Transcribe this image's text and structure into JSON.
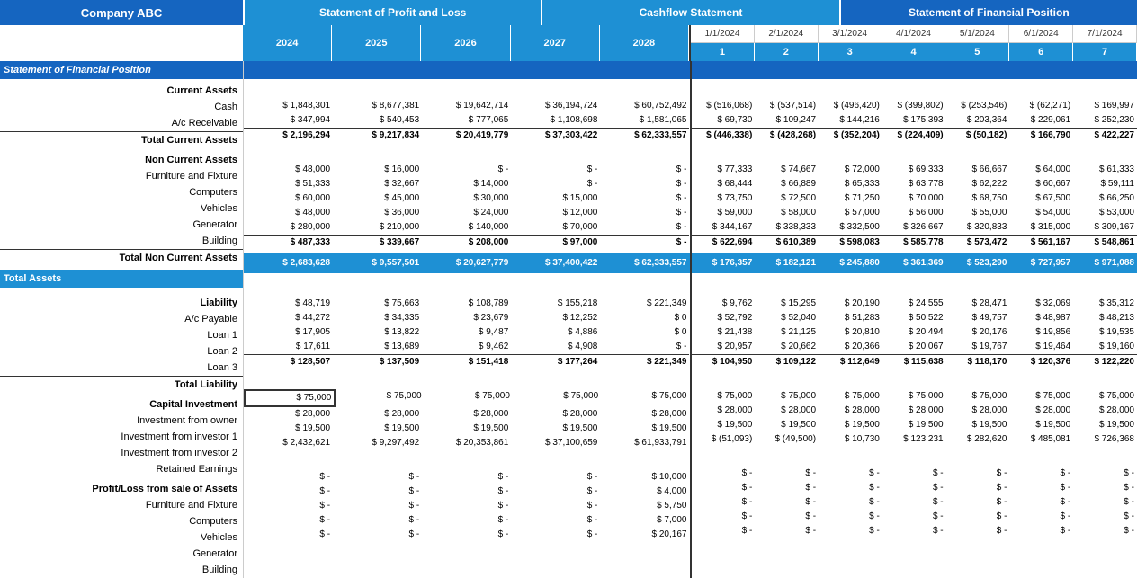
{
  "header": {
    "company": "Company ABC",
    "tab_pl": "Statement of Profit and Loss",
    "tab_cf": "Cashflow Statement",
    "tab_sfp": "Statement of Financial Position"
  },
  "pl_years": [
    "2024",
    "2025",
    "2026",
    "2027",
    "2028"
  ],
  "cf_years": [
    "2024",
    "2025",
    "2026",
    "2027",
    "2028"
  ],
  "sfp_months": [
    {
      "date": "1/1/2024",
      "num": "1"
    },
    {
      "date": "2/1/2024",
      "num": "2"
    },
    {
      "date": "3/1/2024",
      "num": "3"
    },
    {
      "date": "4/1/2024",
      "num": "4"
    },
    {
      "date": "5/1/2024",
      "num": "5"
    },
    {
      "date": "6/1/2024",
      "num": "6"
    },
    {
      "date": "7/1/2024",
      "num": "7"
    }
  ],
  "labels": {
    "section_sfp": "Statement of Financial Position",
    "current_assets": "Current Assets",
    "cash": "Cash",
    "ac_receivable": "A/c Receivable",
    "total_current_assets": "Total Current Assets",
    "non_current_assets": "Non Current Assets",
    "furniture": "Furniture and Fixture",
    "computers": "Computers",
    "vehicles": "Vehicles",
    "generator": "Generator",
    "building": "Building",
    "total_non_current_assets": "Total Non Current Assets",
    "total_assets": "Total Assets",
    "liability": "Liability",
    "ac_payable": "A/c Payable",
    "loan1": "Loan 1",
    "loan2": "Loan 2",
    "loan3": "Loan 3",
    "total_liability": "Total Liability",
    "capital_investment": "Capital Investment",
    "investment_owner": "Investment from owner",
    "investment_investor1": "Investment from investor 1",
    "investment_investor2": "Investment from investor 2",
    "retained_earnings": "Retained Earnings",
    "profit_loss_sale": "Profit/Loss from sale of Assets",
    "furniture2": "Furniture and Fixture",
    "computers2": "Computers",
    "vehicles2": "Vehicles",
    "generator2": "Generator",
    "building2": "Building"
  },
  "pl_data": {
    "cash": [
      "$ 1,848,301",
      "$ 8,677,381",
      "$ 19,642,714",
      "$ 36,194,724",
      "$ 60,752,492"
    ],
    "ac_receivable": [
      "$ 347,994",
      "$ 540,453",
      "$ 777,065",
      "$ 1,108,698",
      "$ 1,581,065"
    ],
    "total_current_assets": [
      "$ 2,196,294",
      "$ 9,217,834",
      "$ 20,419,779",
      "$ 37,303,422",
      "$ 62,333,557"
    ],
    "furniture": [
      "$ 48,000",
      "$ 16,000",
      "$ -",
      "$ -",
      "$ -"
    ],
    "computers": [
      "$ 51,333",
      "$ 32,667",
      "$ 14,000",
      "$ -",
      "$ -"
    ],
    "vehicles": [
      "$ 60,000",
      "$ 45,000",
      "$ 30,000",
      "$ 15,000",
      "$ -"
    ],
    "generator": [
      "$ 48,000",
      "$ 36,000",
      "$ 24,000",
      "$ 12,000",
      "$ -"
    ],
    "building": [
      "$ 280,000",
      "$ 210,000",
      "$ 140,000",
      "$ 70,000",
      "$ -"
    ],
    "total_non_current_assets": [
      "$ 487,333",
      "$ 339,667",
      "$ 208,000",
      "$ 97,000",
      "$ -"
    ],
    "total_assets": [
      "$ 2,683,628",
      "$ 9,557,501",
      "$ 20,627,779",
      "$ 37,400,422",
      "$ 62,333,557"
    ],
    "ac_payable": [
      "$ 48,719",
      "$ 75,663",
      "$ 108,789",
      "$ 155,218",
      "$ 221,349"
    ],
    "loan1": [
      "$ 44,272",
      "$ 34,335",
      "$ 23,679",
      "$ 12,252",
      "$ 0"
    ],
    "loan2": [
      "$ 17,905",
      "$ 13,822",
      "$ 9,487",
      "$ 4,886",
      "$ 0"
    ],
    "loan3": [
      "$ 17,611",
      "$ 13,689",
      "$ 9,462",
      "$ 4,908",
      "$ -"
    ],
    "total_liability": [
      "$ 128,507",
      "$ 137,509",
      "$ 151,418",
      "$ 177,264",
      "$ 221,349"
    ],
    "investment_owner": [
      "$ 75,000",
      "$ 75,000",
      "$ 75,000",
      "$ 75,000",
      "$ 75,000"
    ],
    "investment_investor1": [
      "$ 28,000",
      "$ 28,000",
      "$ 28,000",
      "$ 28,000",
      "$ 28,000"
    ],
    "investment_investor2": [
      "$ 19,500",
      "$ 19,500",
      "$ 19,500",
      "$ 19,500",
      "$ 19,500"
    ],
    "retained_earnings": [
      "$ 2,432,621",
      "$ 9,297,492",
      "$ 20,353,861",
      "$ 37,100,659",
      "$ 61,933,791"
    ],
    "furniture_sale": [
      "$ -",
      "$ -",
      "$ -",
      "$ -",
      "$ 10,000"
    ],
    "computers_sale": [
      "$ -",
      "$ -",
      "$ -",
      "$ -",
      "$ 4,000"
    ],
    "vehicles_sale": [
      "$ -",
      "$ -",
      "$ -",
      "$ -",
      "$ 5,750"
    ],
    "generator_sale": [
      "$ -",
      "$ -",
      "$ -",
      "$ -",
      "$ 7,000"
    ],
    "building_sale": [
      "$ -",
      "$ -",
      "$ -",
      "$ -",
      "$ 20,167"
    ]
  },
  "sfp_data": {
    "cash": [
      "$ (516,068)",
      "$ (537,514)",
      "$ (496,420)",
      "$ (399,802)",
      "$ (253,546)",
      "$ (62,271)",
      "$ 169,997"
    ],
    "ac_receivable": [
      "$ 69,730",
      "$ 109,247",
      "$ 144,216",
      "$ 175,393",
      "$ 203,364",
      "$ 229,061",
      "$ 252,230"
    ],
    "total_current_assets": [
      "$ (446,338)",
      "$ (428,268)",
      "$ (352,204)",
      "$ (224,409)",
      "$ (50,182)",
      "$ 166,790",
      "$ 422,227"
    ],
    "furniture": [
      "$ 77,333",
      "$ 74,667",
      "$ 72,000",
      "$ 69,333",
      "$ 66,667",
      "$ 64,000",
      "$ 61,333"
    ],
    "computers": [
      "$ 68,444",
      "$ 66,889",
      "$ 65,333",
      "$ 63,778",
      "$ 62,222",
      "$ 60,667",
      "$ 59,111"
    ],
    "vehicles": [
      "$ 73,750",
      "$ 72,500",
      "$ 71,250",
      "$ 70,000",
      "$ 68,750",
      "$ 67,500",
      "$ 66,250"
    ],
    "generator": [
      "$ 59,000",
      "$ 58,000",
      "$ 57,000",
      "$ 56,000",
      "$ 55,000",
      "$ 54,000",
      "$ 53,000"
    ],
    "building": [
      "$ 344,167",
      "$ 338,333",
      "$ 332,500",
      "$ 326,667",
      "$ 320,833",
      "$ 315,000",
      "$ 309,167"
    ],
    "total_non_current_assets": [
      "$ 622,694",
      "$ 610,389",
      "$ 598,083",
      "$ 585,778",
      "$ 573,472",
      "$ 561,167",
      "$ 548,861"
    ],
    "total_assets": [
      "$ 176,357",
      "$ 182,121",
      "$ 245,880",
      "$ 361,369",
      "$ 523,290",
      "$ 727,957",
      "$ 971,088"
    ],
    "ac_payable": [
      "$ 9,762",
      "$ 15,295",
      "$ 20,190",
      "$ 24,555",
      "$ 28,471",
      "$ 32,069",
      "$ 35,312"
    ],
    "loan1": [
      "$ 52,792",
      "$ 52,040",
      "$ 51,283",
      "$ 50,522",
      "$ 49,757",
      "$ 48,987",
      "$ 48,213"
    ],
    "loan2": [
      "$ 21,438",
      "$ 21,125",
      "$ 20,810",
      "$ 20,494",
      "$ 20,176",
      "$ 19,856",
      "$ 19,535"
    ],
    "loan3": [
      "$ 20,957",
      "$ 20,662",
      "$ 20,366",
      "$ 20,067",
      "$ 19,767",
      "$ 19,464",
      "$ 19,160"
    ],
    "total_liability": [
      "$ 104,950",
      "$ 109,122",
      "$ 112,649",
      "$ 115,638",
      "$ 118,170",
      "$ 120,376",
      "$ 122,220"
    ],
    "investment_owner": [
      "$ 75,000",
      "$ 75,000",
      "$ 75,000",
      "$ 75,000",
      "$ 75,000",
      "$ 75,000",
      "$ 75,000"
    ],
    "investment_investor1": [
      "$ 28,000",
      "$ 28,000",
      "$ 28,000",
      "$ 28,000",
      "$ 28,000",
      "$ 28,000",
      "$ 28,000"
    ],
    "investment_investor2": [
      "$ 19,500",
      "$ 19,500",
      "$ 19,500",
      "$ 19,500",
      "$ 19,500",
      "$ 19,500",
      "$ 19,500"
    ],
    "retained_earnings": [
      "$ (51,093)",
      "$ (49,500)",
      "$ 10,730",
      "$ 123,231",
      "$ 282,620",
      "$ 485,081",
      "$ 726,368"
    ],
    "furniture_sale": [
      "$ -",
      "$ -",
      "$ -",
      "$ -",
      "$ -",
      "$ -",
      "$ -"
    ],
    "computers_sale": [
      "$ -",
      "$ -",
      "$ -",
      "$ -",
      "$ -",
      "$ -",
      "$ -"
    ],
    "vehicles_sale": [
      "$ -",
      "$ -",
      "$ -",
      "$ -",
      "$ -",
      "$ -",
      "$ -"
    ],
    "generator_sale": [
      "$ -",
      "$ -",
      "$ -",
      "$ -",
      "$ -",
      "$ -",
      "$ -"
    ],
    "building_sale": [
      "$ -",
      "$ -",
      "$ -",
      "$ -",
      "$ -",
      "$ -",
      "$ -"
    ]
  }
}
